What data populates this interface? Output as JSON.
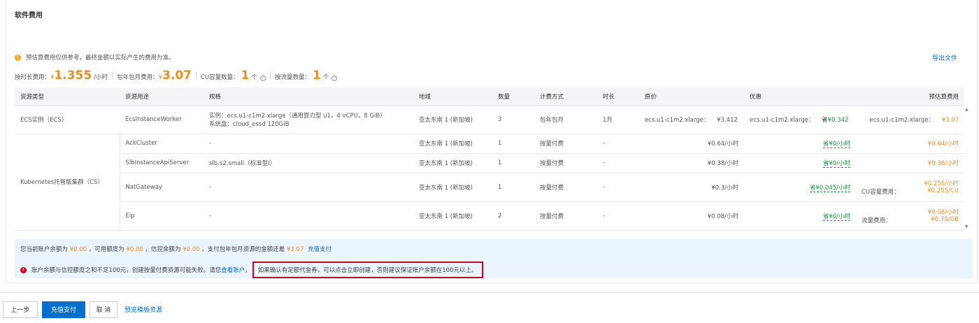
{
  "section_title": "软件费用",
  "notice": "预估算费用仅供参考，最终金额以实际产生的费用为准。",
  "export_label": "导出文件",
  "fees": {
    "hourly_label": "按时长费用：",
    "hourly_currency": "¥",
    "hourly_value": "1.355",
    "hourly_unit": "/小时",
    "monthly_label": "包年包月费用：",
    "monthly_currency": "¥",
    "monthly_value": "3.07",
    "cu_label": "CU容量数量：",
    "cu_value": "1",
    "cu_unit": "个",
    "traffic_label": "按流量数量：",
    "traffic_value": "1",
    "traffic_unit": "个"
  },
  "table": {
    "headers": [
      "资源类型",
      "资源用途",
      "规格",
      "地域",
      "数量",
      "计费方式",
      "时长",
      "原价",
      "优惠",
      "预估算费用"
    ],
    "rows": [
      {
        "type": "ECS实例（ECS）",
        "usage": "EcsInstanceWorker",
        "spec_line1": "实例：ecs.u1-c1m2.xlarge（通用算力型 u1，4 vCPU，8 GiB）",
        "spec_line2": "系统盘：cloud_essd 120GiB",
        "region": "亚太东南 1 (新加坡)",
        "qty": "3",
        "billing": "包年包月",
        "duration": "1月",
        "price_name": "ecs.u1-c1m2.xlarge：",
        "price": "¥3.412",
        "discount_name": "ecs.u1-c1m2.xlarge：",
        "discount": "省¥0.342",
        "est_name": "ecs.u1-c1m2.xlarge：",
        "est": "¥3.07"
      },
      {
        "type": "Kubernetes托管版集群（CS）",
        "usage": "AckCluster",
        "spec": "-",
        "region": "亚太东南 1 (新加坡)",
        "qty": "1",
        "billing": "按量付费",
        "duration": "-",
        "price": "¥0.64/小时",
        "discount": "省¥0/小时",
        "est": "¥0.64/小时"
      },
      {
        "usage": "SlbInstanceApiServer",
        "spec": "slb.s2.small（标准型Ⅰ）",
        "region": "亚太东南 1 (新加坡)",
        "qty": "1",
        "billing": "按量付费",
        "duration": "-",
        "price": "¥0.38/小时",
        "discount": "省¥0/小时",
        "est": "¥0.38/小时"
      },
      {
        "usage": "NatGateway",
        "spec": "-",
        "region": "亚太东南 1 (新加坡)",
        "qty": "1",
        "billing": "按量付费",
        "duration": "-",
        "price": "¥0.3/小时",
        "discount": "省¥0.045/小时",
        "est_line1": "¥0.255/小时",
        "est_line2_label": "CU容量费用：",
        "est_line2": "¥0.255/CU"
      },
      {
        "usage": "Eip",
        "spec": "-",
        "region": "亚太东南 1 (新加坡)",
        "qty": "2",
        "billing": "按量付费",
        "duration": "-",
        "price": "¥0.08/小时",
        "discount": "省¥0/小时",
        "est_line1": "¥0.08/小时",
        "est_line2_label": "流量费用：",
        "est_line2": "¥0.75/GB"
      }
    ]
  },
  "alert": {
    "line1_a": "您当前账户余额为",
    "balance": "¥0.00",
    "line1_b": "，可用额度为",
    "credit": "¥0.00",
    "line1_c": "，信控余额为",
    "control": "¥0.00",
    "line1_d": "，支付包年包月资源的金额还差",
    "shortfall": "¥3.07",
    "recharge_link": "充值支付",
    "line2_a": "账户余额与信控额度之和不足100元，创建按量付费资源可能失败。请您",
    "view_account_link": "查看账户",
    "line2_sep": "，",
    "line2_highlight": "如果确认有足额代金券，可以点击立即创建，否则建议保证账户余额在100元以上。"
  },
  "buttons": {
    "prev": "上一步",
    "recharge": "充值支付",
    "cancel": "取 消",
    "preview": "预览模板资源"
  },
  "colors": {
    "accent": "#0070cc",
    "price_orange": "#f48c1b",
    "discount_green": "#1a8f3a",
    "error_red": "#d9001b"
  }
}
